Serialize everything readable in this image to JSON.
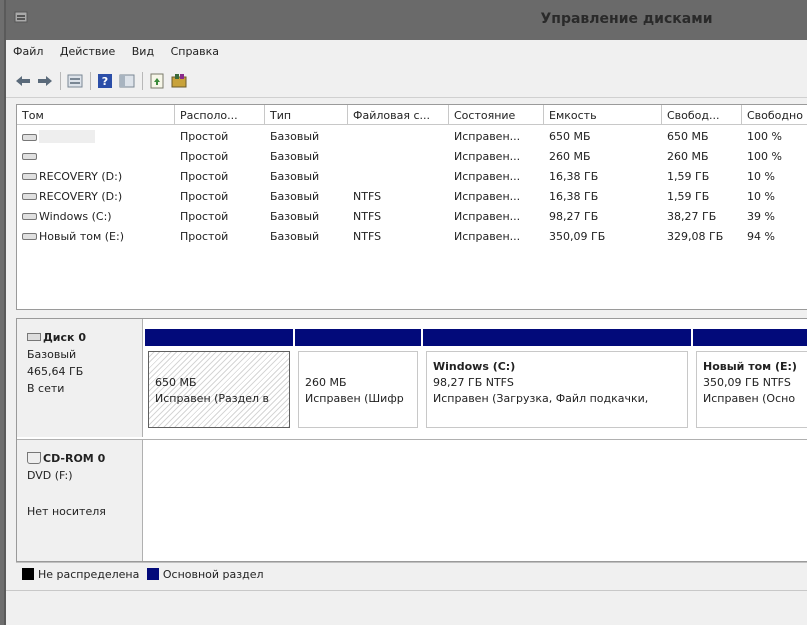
{
  "window": {
    "title": "Управление дисками"
  },
  "menu": [
    "Файл",
    "Действие",
    "Вид",
    "Справка"
  ],
  "toolbar": {
    "icons": [
      "back-arrow-icon",
      "forward-arrow-icon",
      "list-view-icon",
      "help-icon",
      "console-view-icon",
      "refresh-icon",
      "properties-icon"
    ]
  },
  "volumes": {
    "columns": [
      "Том",
      "Располо...",
      "Тип",
      "Файловая с...",
      "Состояние",
      "Емкость",
      "Свобод...",
      "Свободно"
    ],
    "rows": [
      {
        "name": "",
        "layout": "Простой",
        "type": "Базовый",
        "fs": "",
        "status": "Исправен...",
        "capacity": "650 МБ",
        "free": "650 МБ",
        "pct": "100 %"
      },
      {
        "name": "",
        "layout": "Простой",
        "type": "Базовый",
        "fs": "",
        "status": "Исправен...",
        "capacity": "260 МБ",
        "free": "260 МБ",
        "pct": "100 %"
      },
      {
        "name": "RECOVERY (D:)",
        "layout": "Простой",
        "type": "Базовый",
        "fs": "",
        "status": "Исправен...",
        "capacity": "16,38 ГБ",
        "free": "1,59 ГБ",
        "pct": "10 %"
      },
      {
        "name": "RECOVERY (D:)",
        "layout": "Простой",
        "type": "Базовый",
        "fs": "NTFS",
        "status": "Исправен...",
        "capacity": "16,38 ГБ",
        "free": "1,59 ГБ",
        "pct": "10 %"
      },
      {
        "name": "Windows (C:)",
        "layout": "Простой",
        "type": "Базовый",
        "fs": "NTFS",
        "status": "Исправен...",
        "capacity": "98,27 ГБ",
        "free": "38,27 ГБ",
        "pct": "39 %"
      },
      {
        "name": "Новый том (E:)",
        "layout": "Простой",
        "type": "Базовый",
        "fs": "NTFS",
        "status": "Исправен...",
        "capacity": "350,09 ГБ",
        "free": "329,08 ГБ",
        "pct": "94 %"
      }
    ]
  },
  "disk0": {
    "name": "Диск 0",
    "type": "Базовый",
    "size": "465,64 ГБ",
    "state": "В сети",
    "partitions": [
      {
        "name": "",
        "size": "650 МБ",
        "status": "Исправен (Раздел в"
      },
      {
        "name": "",
        "size": "260 МБ",
        "status": "Исправен (Шифр"
      },
      {
        "name": "Windows  (C:)",
        "size": "98,27 ГБ NTFS",
        "status": "Исправен (Загрузка, Файл подкачки,"
      },
      {
        "name": "Новый том  (E:)",
        "size": "350,09 ГБ NTFS",
        "status": "Исправен (Осно"
      }
    ]
  },
  "cdrom": {
    "name": "CD-ROM 0",
    "type": "DVD (F:)",
    "state": "Нет носителя"
  },
  "legend": [
    {
      "label": "Не распределена",
      "color": "#000000"
    },
    {
      "label": "Основной раздел",
      "color": "#020a7a"
    }
  ]
}
